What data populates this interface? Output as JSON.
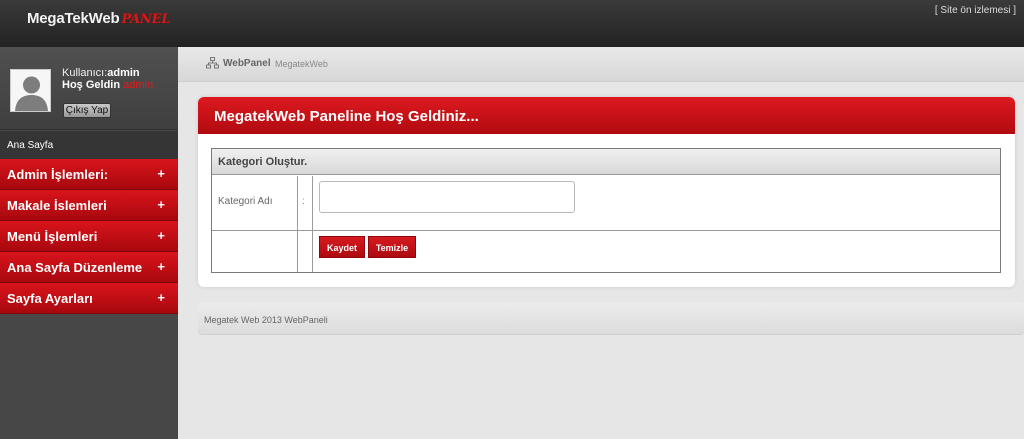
{
  "header": {
    "logo_main": "MegaTekWeb",
    "logo_accent": "PANEL",
    "site_preview_link": "[ Site ön izlemesi ]"
  },
  "user": {
    "username_label": "Kullanıcı:",
    "username": "admin",
    "welcome_label": "Hoş Geldin",
    "welcome_name": "admin",
    "logout_label": "Çıkış Yap"
  },
  "sidebar": {
    "home_label": "Ana Sayfa",
    "items": [
      {
        "label": "Admin İşlemleri:",
        "icon": "+"
      },
      {
        "label": "Makale İslemleri",
        "icon": "+"
      },
      {
        "label": "Menü İşlemleri",
        "icon": "+"
      },
      {
        "label": "Ana Sayfa Düzenleme",
        "icon": "+"
      },
      {
        "label": "Sayfa Ayarları",
        "icon": "+"
      }
    ]
  },
  "breadcrumb": {
    "strong": "WebPanel",
    "light": "MegatekWeb"
  },
  "panel": {
    "title": "MegatekWeb Paneline Hoş Geldiniz..."
  },
  "form": {
    "caption": "Kategori Oluştur.",
    "field_label": "Kategori Adı",
    "separator": ":",
    "field_value": "",
    "save_label": "Kaydet",
    "clear_label": "Temizle"
  },
  "footer": {
    "text": "Megatek Web 2013 WebPaneli"
  },
  "colors": {
    "accent_red": "#c8101a",
    "dark_bg": "#2e2e2e",
    "sidebar_bg": "#474747"
  }
}
